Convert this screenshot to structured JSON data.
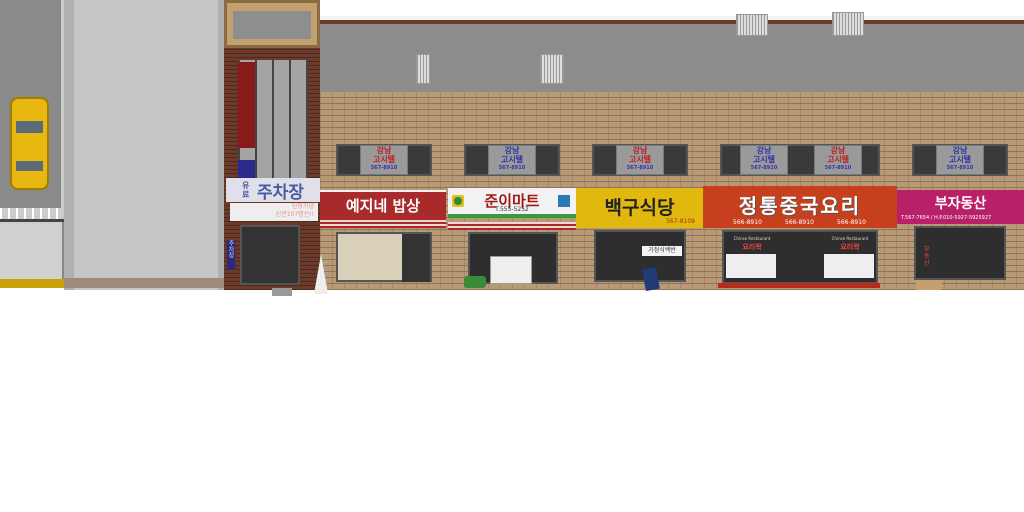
{
  "parking": {
    "small": "유료",
    "name": "주차장",
    "banner_line1": "단장기념",
    "banner_line2": "신관107명선!!",
    "side": "주차장"
  },
  "gositel": {
    "area": "강남",
    "name": "고시텔",
    "phone": "567-8910"
  },
  "shops": [
    {
      "name": "예지네 밥상",
      "color": "#a82a2a"
    },
    {
      "name": "준이마트",
      "phone": "T.555-5252",
      "color": "#f2f2f2"
    },
    {
      "name": "백구식당",
      "phone": "567-8109",
      "color": "#e0b80e",
      "window": "가정식백반"
    },
    {
      "name": "정통중국요리",
      "phones": [
        "566-8910",
        "566-8910",
        "566-8910"
      ],
      "color": "#c7401e",
      "poster_en": "Chinse Restaurant",
      "poster_ko": "요리왁"
    },
    {
      "name": "부자동산",
      "phone": "T.567-7654 / H.P.010-5927-5925927",
      "color": "#b8206a",
      "door": "부동산"
    }
  ]
}
